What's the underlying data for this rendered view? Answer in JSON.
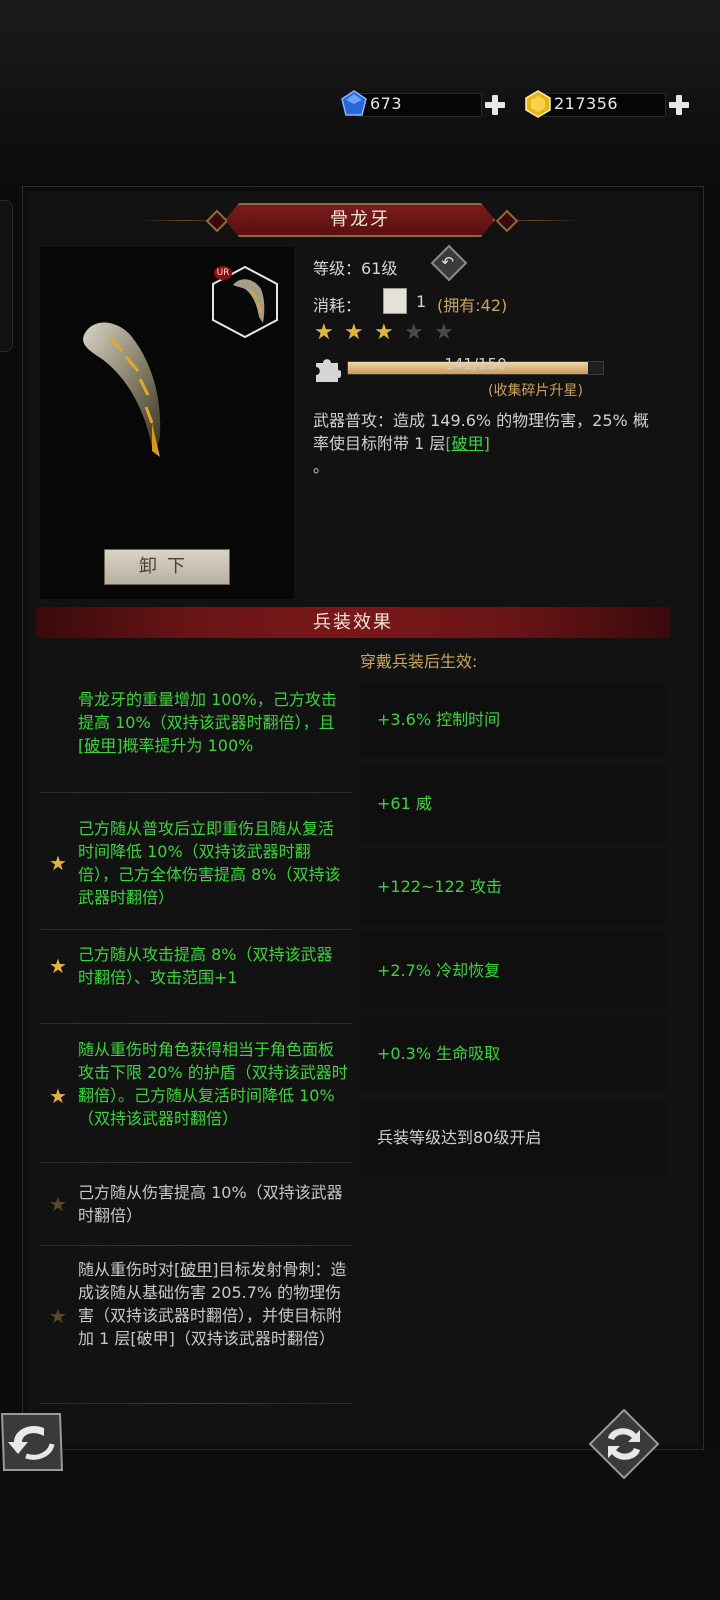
{
  "currency": {
    "gems": "673",
    "gold": "217356"
  },
  "item": {
    "name": "骨龙牙",
    "rarity_badge": "UR",
    "level_label": "等级：",
    "level_value": "61级",
    "cost_label": "消耗：",
    "cost_qty": "1",
    "owned_text": "(拥有:42)",
    "stars_total": 5,
    "stars_filled": 3,
    "shards_progress": "141/150",
    "shards_fraction": 0.94,
    "shards_hint": "(收集碎片升星)",
    "desc_part1": "武器普攻：造成 149.6% 的物理伤害，25% 概率使目标附带 1 层",
    "desc_link": "[破甲]",
    "desc_part2": "。",
    "unload_label": "卸下"
  },
  "section": {
    "title": "兵装效果",
    "stats_heading": "穿戴兵装后生效:"
  },
  "effects": [
    {
      "parts": [
        "骨龙牙的重量增加 100%，己方攻击提高 10%（双持该武器时翻倍），且",
        "[破甲]",
        "概率提升为 100%"
      ],
      "starred": false,
      "active": true
    },
    {
      "text": "己方随从普攻后立即重伤且随从复活时间降低 10%（双持该武器时翻倍），己方全体伤害提高 8%（双持该武器时翻倍）",
      "starred": true,
      "active": true
    },
    {
      "text": "己方随从攻击提高 8%（双持该武器时翻倍）、攻击范围+1",
      "starred": true,
      "active": true
    },
    {
      "text": "随从重伤时角色获得相当于角色面板攻击下限 20% 的护盾（双持该武器时翻倍）。己方随从复活时间降低 10%（双持该武器时翻倍）",
      "starred": true,
      "active": true
    },
    {
      "text": "己方随从伤害提高 10%（双持该武器时翻倍）",
      "starred": true,
      "active": false
    },
    {
      "parts": [
        "随从重伤时对",
        "[破甲]",
        "目标发射骨刺：造成该随从基础伤害 205.7% 的物理伤害（双持该武器时翻倍），并使目标附加 1 层[破甲]（双持该武器时翻倍）"
      ],
      "starred": true,
      "active": false
    }
  ],
  "stats": [
    {
      "text": "+3.6% 控制时间",
      "active": true
    },
    {
      "text": "+61 威",
      "active": true
    },
    {
      "text": "+122~122 攻击",
      "active": true
    },
    {
      "text": "+2.7% 冷却恢复",
      "active": true
    },
    {
      "text": "+0.3% 生命吸取",
      "active": true
    },
    {
      "text": "兵装等级达到80级开启",
      "active": false
    }
  ],
  "colors": {
    "active_green": "#3bd33b",
    "gold": "#c9a35a",
    "banner_red": "#7a1718"
  },
  "icons": [
    "blue-gem-icon",
    "gold-coin-icon",
    "plus-icon",
    "reset-icon",
    "scroll-icon",
    "star-icon",
    "puzzle-icon",
    "back-arrow-icon",
    "swap-icon"
  ]
}
